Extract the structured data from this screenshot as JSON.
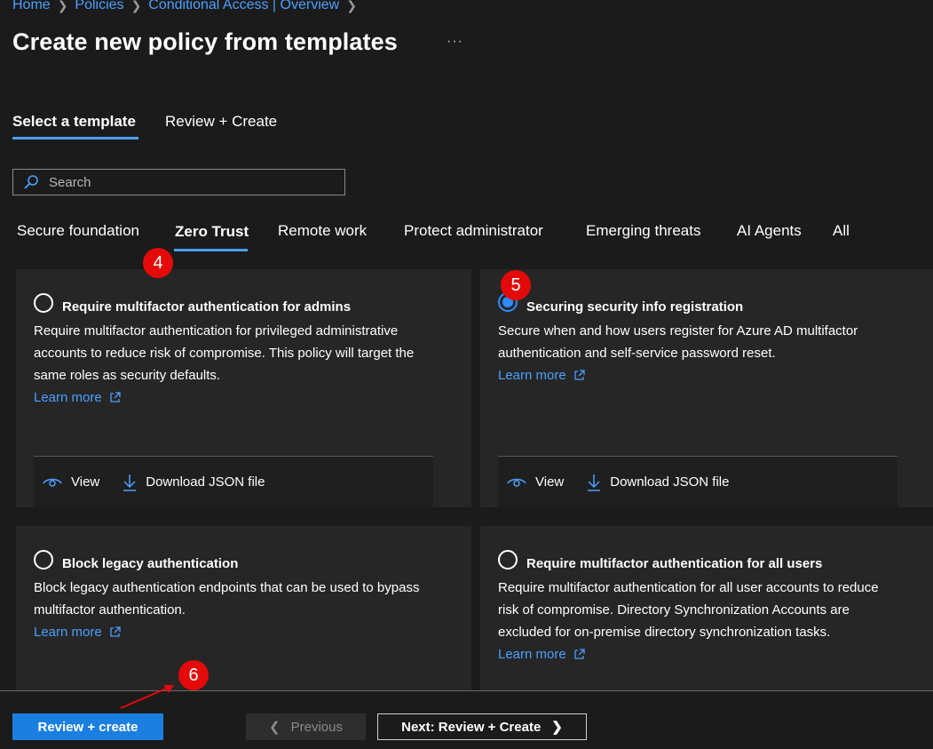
{
  "breadcrumb": {
    "items": [
      "Home",
      "Policies",
      "Conditional Access | Overview"
    ]
  },
  "header": {
    "title": "Create new policy from templates",
    "more": "···"
  },
  "wizard_tabs": [
    {
      "label": "Select a template",
      "active": true
    },
    {
      "label": "Review + Create",
      "active": false
    }
  ],
  "search": {
    "placeholder": "Search",
    "value": ""
  },
  "category_tabs": [
    {
      "label": "Secure foundation",
      "active": false
    },
    {
      "label": "Zero Trust",
      "active": true
    },
    {
      "label": "Remote work",
      "active": false
    },
    {
      "label": "Protect administrator",
      "active": false
    },
    {
      "label": "Emerging threats",
      "active": false
    },
    {
      "label": "AI Agents",
      "active": false
    },
    {
      "label": "All",
      "active": false
    }
  ],
  "templates": [
    {
      "title": "Require multifactor authentication for admins",
      "description_lines": [
        "Require multifactor authentication for privileged administrative",
        "accounts to reduce risk of compromise. This policy will target the",
        "same roles as security defaults."
      ],
      "learn_more": "Learn more",
      "selected": false,
      "view_label": "View",
      "download_label": "Download JSON file"
    },
    {
      "title": "Securing security info registration",
      "description_lines": [
        "Secure when and how users register for Azure AD multifactor",
        "authentication and self-service password reset."
      ],
      "learn_more": "Learn more",
      "selected": true,
      "view_label": "View",
      "download_label": "Download JSON file"
    },
    {
      "title": "Block legacy authentication",
      "description_lines": [
        "Block legacy authentication endpoints that can be used to bypass",
        "multifactor authentication."
      ],
      "learn_more": "Learn more",
      "selected": false
    },
    {
      "title": "Require multifactor authentication for all users",
      "description_lines": [
        "Require multifactor authentication for all user accounts to reduce",
        "risk of compromise. Directory Synchronization Accounts are",
        "excluded for on-premise directory synchronization tasks."
      ],
      "learn_more": "Learn more",
      "selected": false
    }
  ],
  "annotations": {
    "step4": "4",
    "step5": "5",
    "step6": "6"
  },
  "footer": {
    "primary_label": "Review + create",
    "previous_label": "Previous",
    "next_label": "Next: Review + Create"
  },
  "icons": {
    "search": "search-icon",
    "view": "eye-icon",
    "download": "download-icon",
    "external": "external-link-icon",
    "chevron_left": "chevron-left-icon",
    "chevron_right": "chevron-right-icon"
  },
  "colors": {
    "background": "#1b1b1b",
    "card": "#262626",
    "accent": "#4aa0ff",
    "primary_button": "#1a7fe0",
    "annotation": "#e40a0a"
  }
}
